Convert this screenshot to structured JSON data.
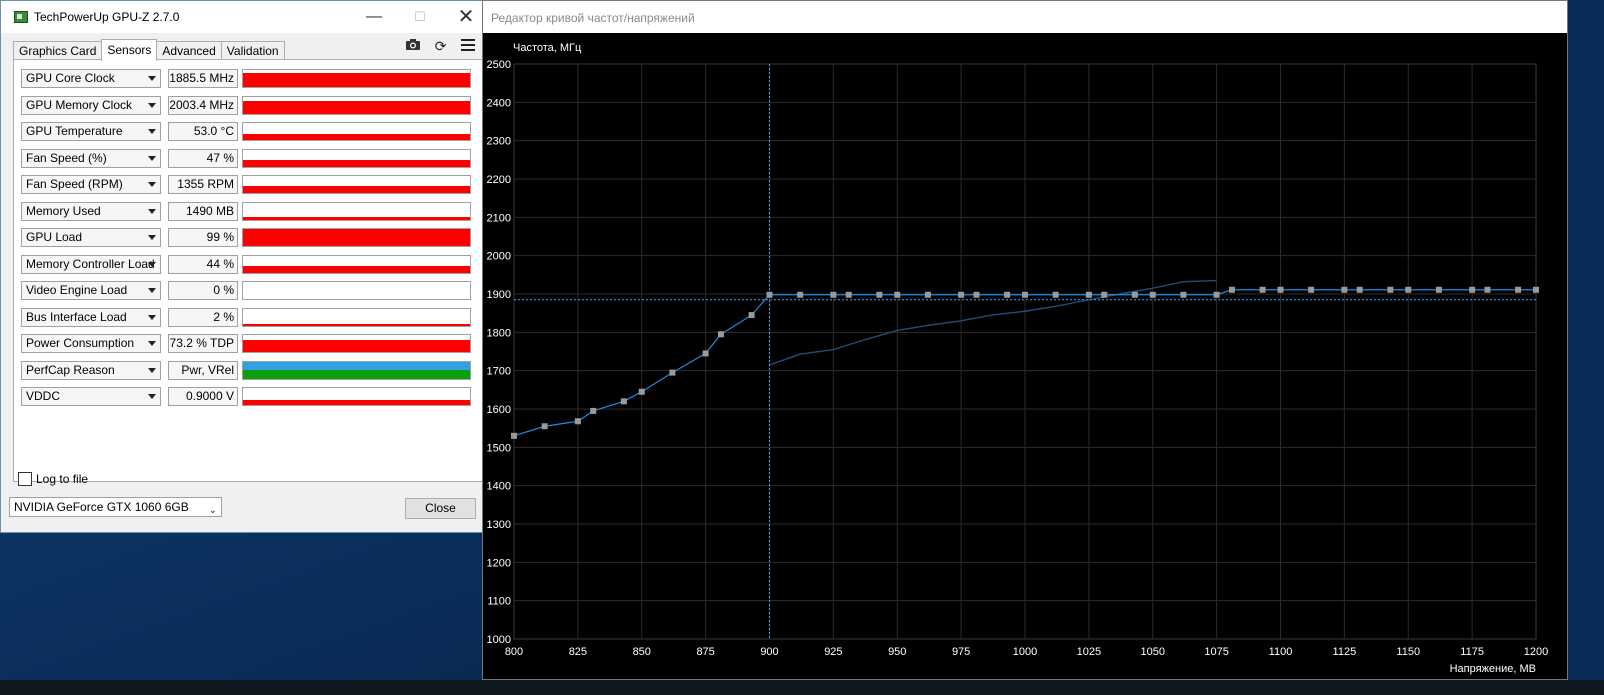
{
  "gpuz": {
    "title": "TechPowerUp GPU-Z 2.7.0",
    "tabs": [
      "Graphics Card",
      "Sensors",
      "Advanced",
      "Validation"
    ],
    "active_tab": "Sensors",
    "icons": [
      "camera-icon",
      "refresh-icon",
      "menu-icon"
    ],
    "sensors": [
      {
        "name": "GPU Core Clock",
        "value": "1885.5 MHz",
        "level": 0.8
      },
      {
        "name": "GPU Memory Clock",
        "value": "2003.4 MHz",
        "level": 0.75
      },
      {
        "name": "GPU Temperature",
        "value": "53.0 °C",
        "level": 0.35
      },
      {
        "name": "Fan Speed (%)",
        "value": "47 %",
        "level": 0.4
      },
      {
        "name": "Fan Speed (RPM)",
        "value": "1355 RPM",
        "level": 0.4
      },
      {
        "name": "Memory Used",
        "value": "1490 MB",
        "level": 0.2
      },
      {
        "name": "GPU Load",
        "value": "99 %",
        "level": 0.99
      },
      {
        "name": "Memory Controller Load",
        "value": "44 %",
        "level": 0.44
      },
      {
        "name": "Video Engine Load",
        "value": "0 %",
        "level": 0
      },
      {
        "name": "Bus Interface Load",
        "value": "2 %",
        "level": 0.02
      },
      {
        "name": "Power Consumption",
        "value": "73.2 % TDP",
        "level": 0.73
      },
      {
        "name": "PerfCap Reason",
        "value": "Pwr, VRel",
        "level": 1
      },
      {
        "name": "VDDC",
        "value": "0.9000 V",
        "level": 0.3
      }
    ],
    "log_to_file": "Log to file",
    "gpu_select": "NVIDIA GeForce GTX 1060 6GB",
    "close_label": "Close"
  },
  "curve_editor": {
    "title": "Редактор кривой частот/напряжений",
    "chart_data": {
      "type": "line",
      "xlabel": "Напряжение, МВ",
      "ylabel": "Частота, МГц",
      "xlim": [
        800,
        1200
      ],
      "ylim": [
        1000,
        2500
      ],
      "xticks": [
        800,
        825,
        850,
        875,
        900,
        925,
        950,
        975,
        1000,
        1025,
        1050,
        1075,
        1100,
        1125,
        1150,
        1175,
        1200
      ],
      "yticks": [
        1000,
        1100,
        1200,
        1300,
        1400,
        1500,
        1600,
        1700,
        1800,
        1900,
        2000,
        2100,
        2200,
        2300,
        2400,
        2500
      ],
      "grid": true,
      "current_point": {
        "voltage": 900,
        "frequency": 1885
      },
      "series": [
        {
          "x": [
            800,
            812,
            825,
            831,
            843,
            850,
            862,
            875,
            881,
            893,
            900,
            912,
            925,
            931,
            943,
            950,
            962,
            975,
            981,
            993,
            1000,
            1012,
            1025,
            1031,
            1043,
            1050,
            1062,
            1075,
            1081,
            1093,
            1100,
            1112,
            1125,
            1131,
            1143,
            1150,
            1162,
            1175,
            1181,
            1193,
            1200
          ],
          "y": [
            1530,
            1555,
            1568,
            1595,
            1620,
            1645,
            1695,
            1745,
            1795,
            1845,
            1898,
            1898,
            1898,
            1898,
            1898,
            1898,
            1898,
            1898,
            1898,
            1898,
            1898,
            1898,
            1898,
            1898,
            1898,
            1898,
            1898,
            1898,
            1911,
            1911,
            1911,
            1911,
            1911,
            1911,
            1911,
            1911,
            1911,
            1911,
            1911,
            1911,
            1911
          ]
        },
        {
          "x": [
            900,
            912,
            925,
            937,
            950,
            962,
            975,
            987,
            1000,
            1012,
            1025,
            1037,
            1050,
            1062,
            1075
          ],
          "y": [
            1715,
            1743,
            1755,
            1780,
            1805,
            1818,
            1830,
            1845,
            1855,
            1868,
            1885,
            1900,
            1915,
            1932,
            1935
          ]
        }
      ]
    }
  }
}
